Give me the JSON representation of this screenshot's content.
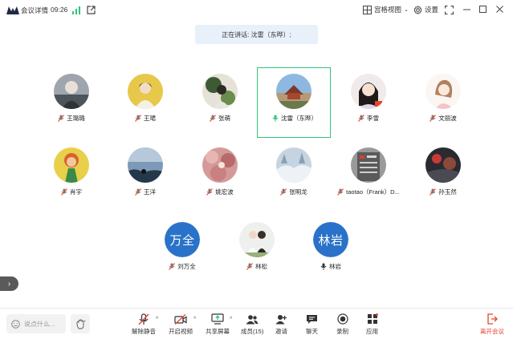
{
  "topbar": {
    "info_label": "会议详情",
    "time": "09:26",
    "view_label": "宫格视图",
    "settings_label": "设置"
  },
  "speaker_banner": "正在讲话: 沈雷（东晔）;",
  "participants": [
    {
      "name": "王璐璐",
      "mic": "muted"
    },
    {
      "name": "王珺",
      "mic": "muted"
    },
    {
      "name": "张萌",
      "mic": "muted"
    },
    {
      "name": "沈雷（东晔）",
      "mic": "speaking"
    },
    {
      "name": "李雪",
      "mic": "muted"
    },
    {
      "name": "文丽波",
      "mic": "muted"
    },
    {
      "name": "肖宇",
      "mic": "muted"
    },
    {
      "name": "王洋",
      "mic": "muted"
    },
    {
      "name": "姚宏波",
      "mic": "muted"
    },
    {
      "name": "张明龙",
      "mic": "muted"
    },
    {
      "name": "taotao（Frank）D...",
      "mic": "muted"
    },
    {
      "name": "孙玉然",
      "mic": "muted"
    },
    {
      "name": "刘万全",
      "mic": "muted",
      "avatar_text": "万全"
    },
    {
      "name": "林松",
      "mic": "muted"
    },
    {
      "name": "林岩",
      "mic": "on",
      "avatar_text": "林岩"
    }
  ],
  "bottombar": {
    "chat_placeholder": "说点什么...",
    "tools": {
      "unmute": "解除静音",
      "video": "开启视频",
      "share": "共享屏幕",
      "members": "成员(15)",
      "invite": "邀请",
      "chat": "聊天",
      "record": "录制",
      "apps": "应用",
      "leave": "离开会议"
    }
  },
  "colors": {
    "accent": "#2fc37a",
    "avatar_blue": "#2a72c9",
    "leave_red": "#e8442d",
    "banner_bg": "#e8f0fa"
  }
}
